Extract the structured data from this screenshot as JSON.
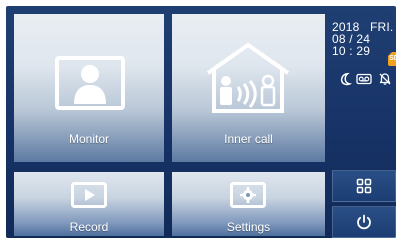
{
  "tiles": {
    "monitor": {
      "label": "Monitor"
    },
    "inner_call": {
      "label": "Inner call"
    },
    "record": {
      "label": "Record"
    },
    "settings": {
      "label": "Settings"
    }
  },
  "status": {
    "year": "2018",
    "weekday": "FRI.",
    "date": "08 / 24",
    "time": "10 : 29",
    "sd_badge": "SD",
    "icons": [
      "moon-icon",
      "voicemail-icon",
      "bell-muted-icon"
    ]
  },
  "side_buttons": {
    "menu_icon": "grid-icon",
    "power_icon": "power-icon"
  },
  "colors": {
    "screen_bg": "#173266",
    "tile_light": "#e9eef3",
    "tile_dark": "#5d7aa2",
    "sd_orange": "#f2a11d"
  }
}
